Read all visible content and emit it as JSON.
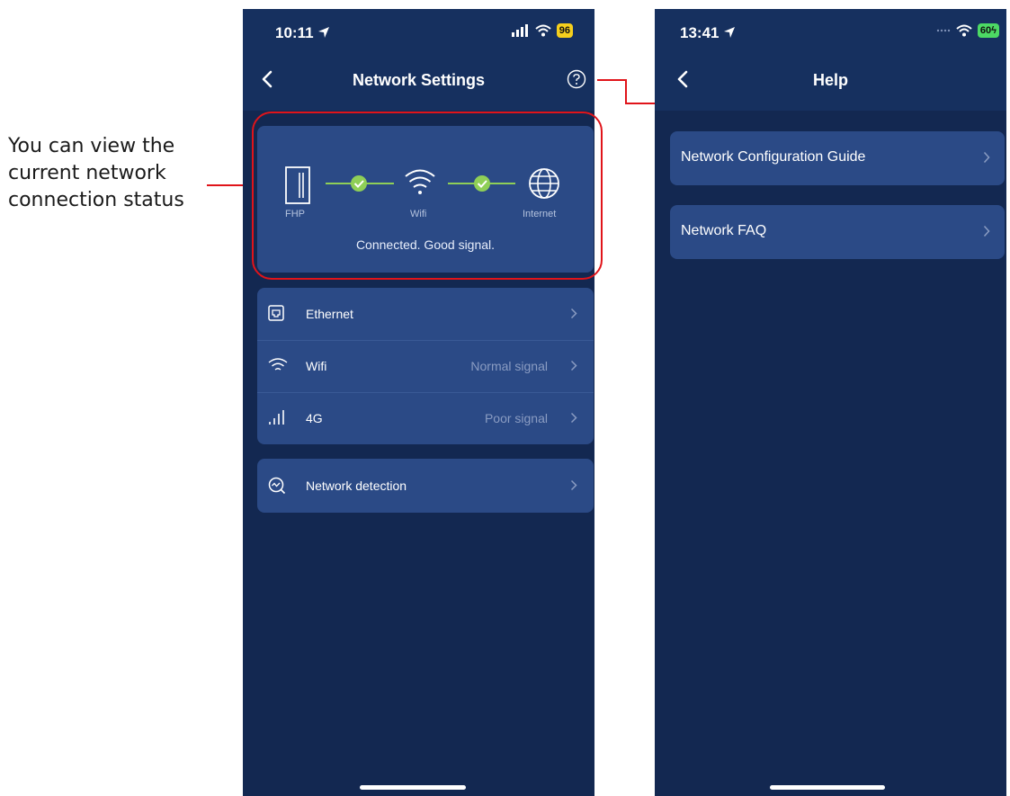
{
  "annotation": {
    "lines": [
      "You can view the",
      "current network",
      "connection status"
    ]
  },
  "left_screen": {
    "status_time": "10:11",
    "battery": "96",
    "title": "Network Settings",
    "nodes": {
      "fhp": "FHP",
      "wifi": "Wifi",
      "internet": "Internet"
    },
    "status_message": "Connected. Good signal.",
    "connections": [
      {
        "label": "Ethernet",
        "value": ""
      },
      {
        "label": "Wifi",
        "value": "Normal signal"
      },
      {
        "label": "4G",
        "value": "Poor signal"
      }
    ],
    "detection": {
      "label": "Network detection"
    }
  },
  "right_screen": {
    "status_time": "13:41",
    "battery": "60",
    "title": "Help",
    "items": [
      {
        "label": "Network Configuration Guide"
      },
      {
        "label": "Network FAQ"
      }
    ]
  },
  "colors": {
    "background": "#132851",
    "card": "#2b4a86",
    "accent_green": "#8fcf57",
    "battery_yellow": "#f5cf1d",
    "battery_green": "#4cd964",
    "annotation_red": "#e0141a"
  }
}
